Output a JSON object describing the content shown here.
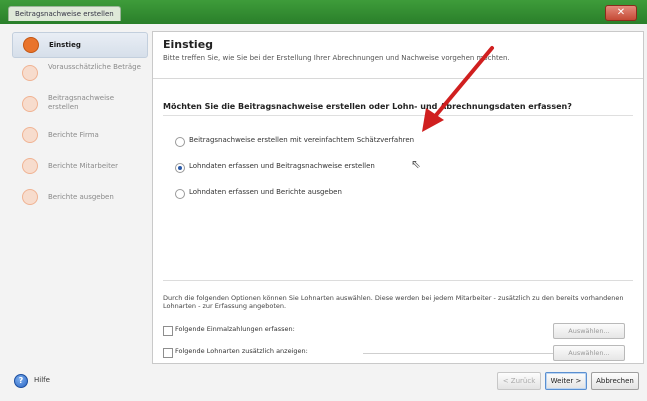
{
  "window": {
    "title": "Beitragsnachweise erstellen",
    "close_glyph": "✕"
  },
  "sidebar": {
    "items": [
      {
        "label": "Einstieg",
        "active": true
      },
      {
        "label": "Vorausschätzliche Beträge",
        "active": false
      },
      {
        "label": "Beitragsnachweise erstellen",
        "active": false
      },
      {
        "label": "Berichte Firma",
        "active": false
      },
      {
        "label": "Berichte Mitarbeiter",
        "active": false
      },
      {
        "label": "Berichte ausgeben",
        "active": false
      }
    ]
  },
  "main": {
    "title": "Einstieg",
    "subtitle": "Bitte treffen Sie, wie Sie bei der Erstellung Ihrer Abrechnungen und Nachweise vorgehen möchten.",
    "question": "Möchten Sie die Beitragsnachweise erstellen oder Lohn- und Abrechnungsdaten erfassen?",
    "options": [
      {
        "label": "Beitragsnachweise erstellen mit vereinfachtem Schätzverfahren",
        "checked": false
      },
      {
        "label": "Lohndaten erfassen und Beitragsnachweise erstellen",
        "checked": true
      },
      {
        "label": "Lohndaten erfassen und Berichte ausgeben",
        "checked": false
      }
    ],
    "description": "Durch die folgenden Optionen können Sie Lohnarten auswählen. Diese werden bei jedem Mitarbeiter - zusätzlich zu den bereits vorhandenen Lohnarten - zur Erfassung angeboten.",
    "extra_options": [
      {
        "label": "Folgende Einmalzahlungen erfassen:",
        "button": "Auswählen..."
      },
      {
        "label": "Folgende Lohnarten zusätzlich anzeigen:",
        "button": "Auswählen..."
      }
    ]
  },
  "footer": {
    "help_label": "Hilfe",
    "help_glyph": "?",
    "back_label": "< Zurück",
    "next_label": "Weiter >",
    "cancel_label": "Abbrechen"
  },
  "colors": {
    "accent": "#e9742c",
    "title_bar": "#2a7f2a",
    "annotation_arrow": "#d01f1f"
  },
  "icons": [
    "step-circle-icon",
    "help-icon",
    "close-icon",
    "mouse-cursor-icon",
    "annotation-arrow-icon"
  ]
}
